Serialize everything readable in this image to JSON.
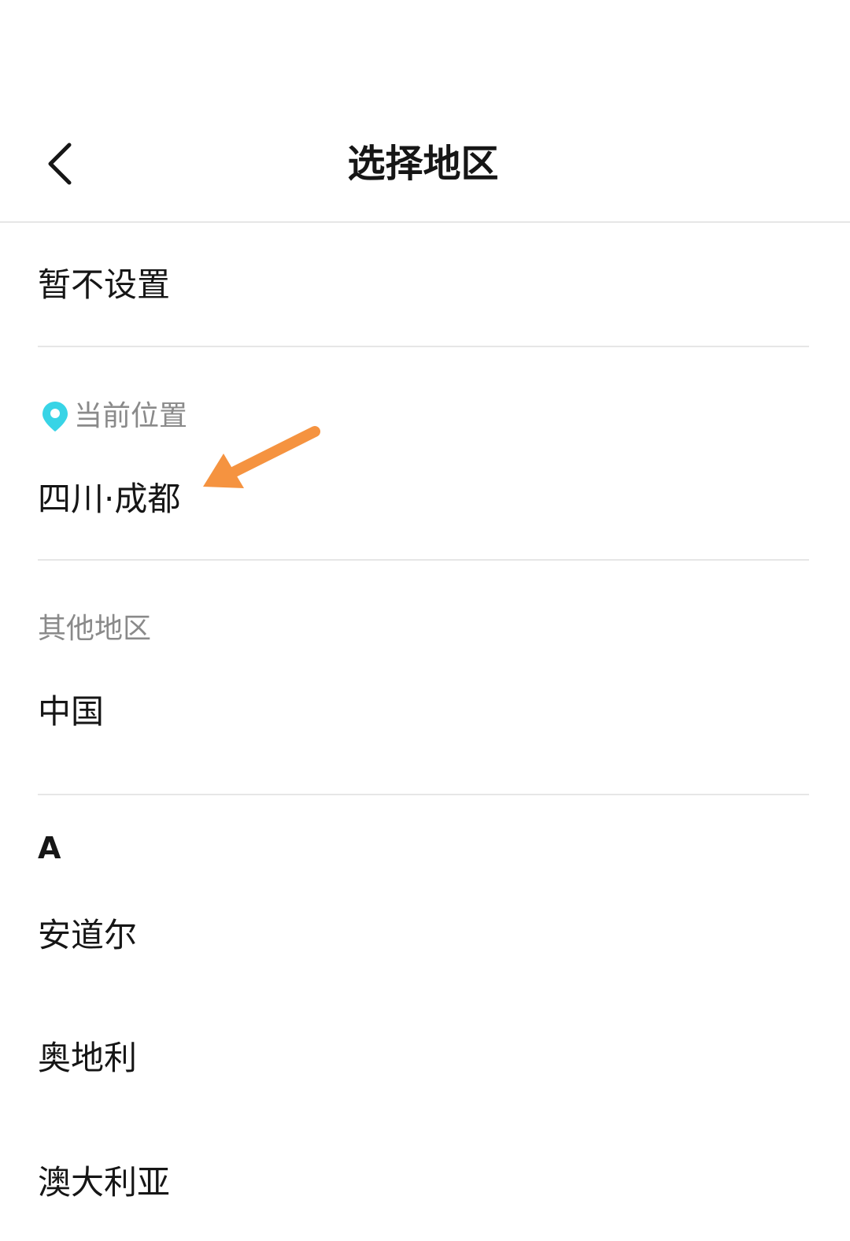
{
  "header": {
    "title": "选择地区",
    "back_icon": "chevron-left-icon"
  },
  "no_setting": {
    "label": "暂不设置"
  },
  "current_location": {
    "section_label": "当前位置",
    "icon": "location-pin-icon",
    "icon_color": "#38d4e6",
    "value": "四川·成都"
  },
  "other_regions": {
    "section_label": "其他地区",
    "items": [
      {
        "label": "中国"
      }
    ]
  },
  "alphabet_groups": [
    {
      "letter": "A",
      "items": [
        {
          "label": "安道尔"
        },
        {
          "label": "奥地利"
        },
        {
          "label": "澳大利亚"
        }
      ]
    }
  ],
  "annotation": {
    "arrow_color": "#f59340"
  }
}
